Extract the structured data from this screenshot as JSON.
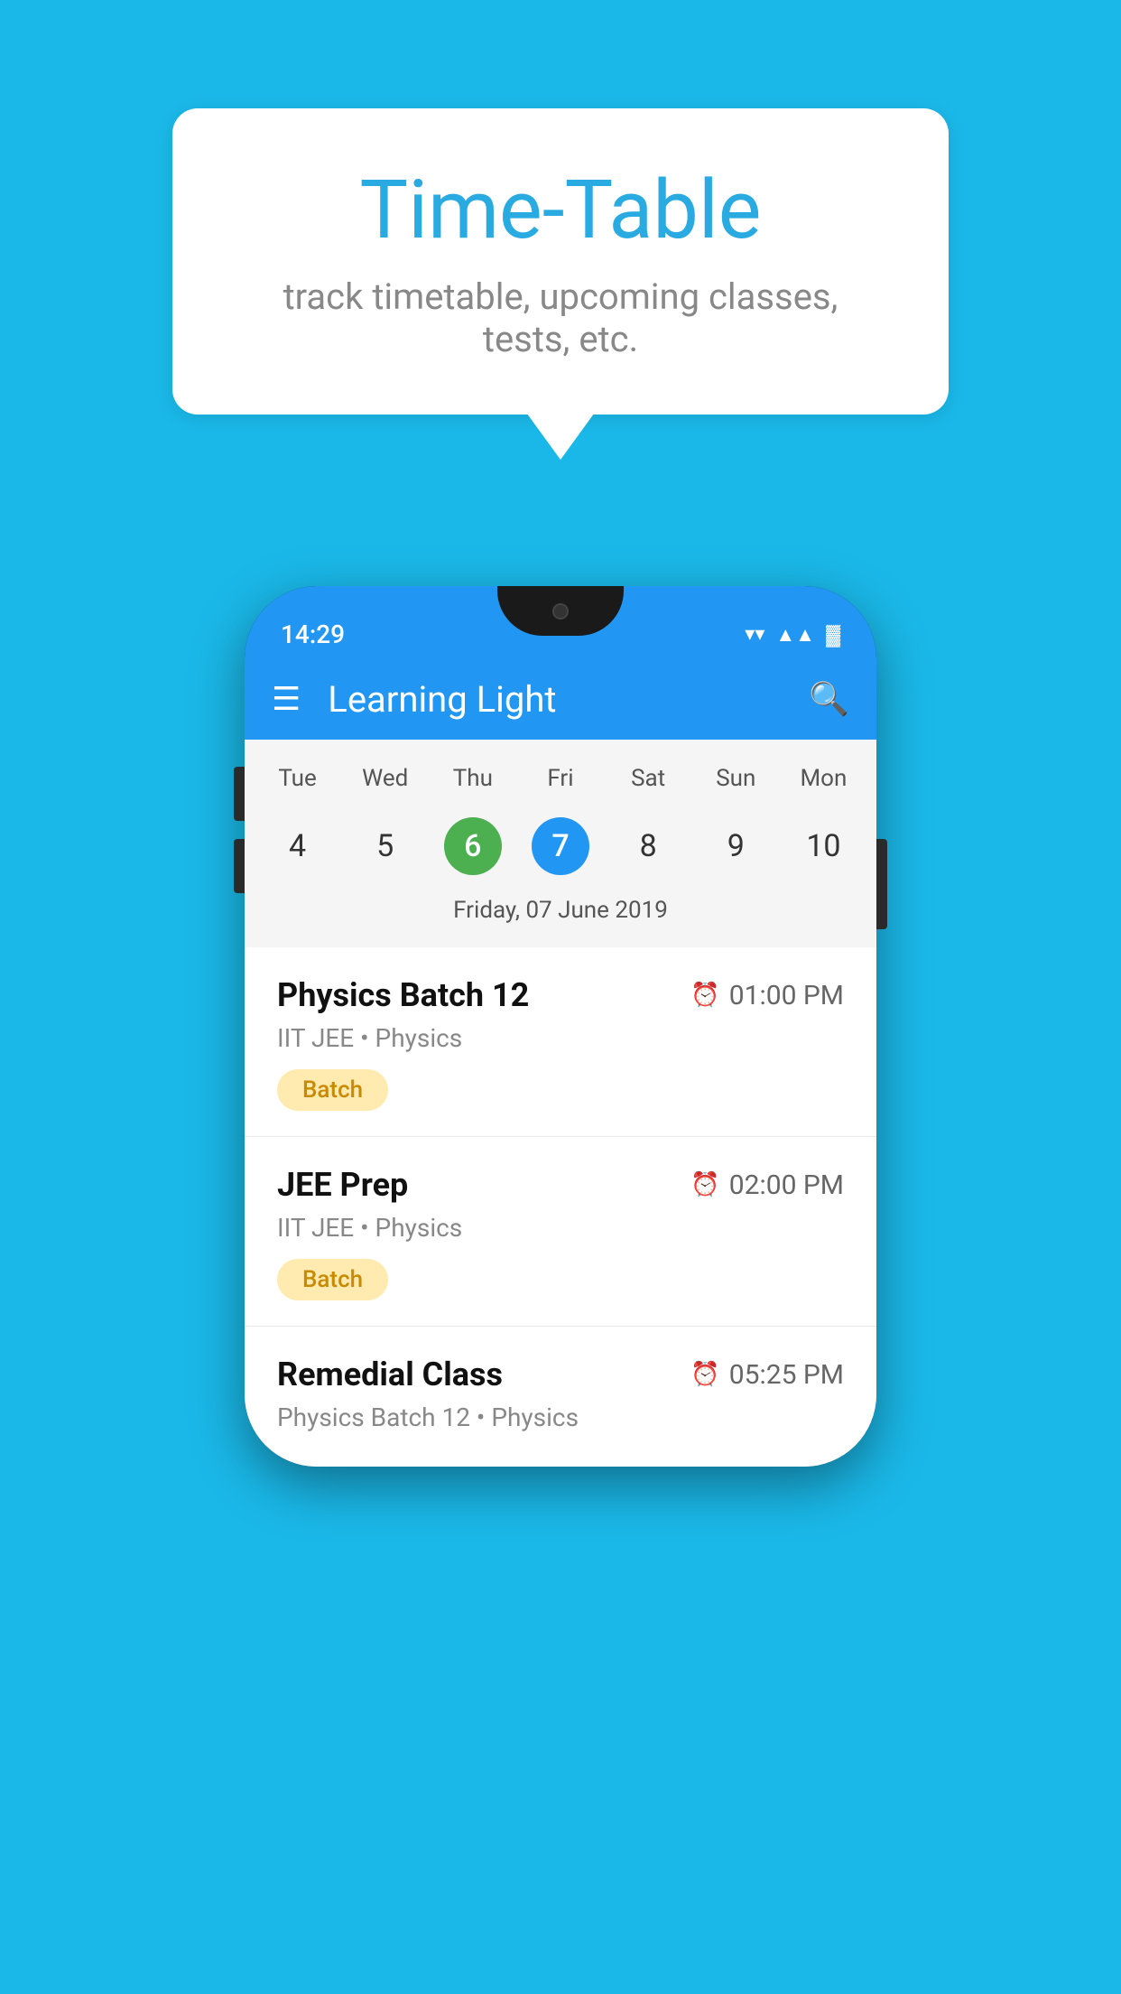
{
  "hero": {
    "title": "Time-Table",
    "subtitle": "track timetable, upcoming classes, tests, etc."
  },
  "statusBar": {
    "time": "14:29",
    "icons": [
      "wifi",
      "signal",
      "battery"
    ]
  },
  "appBar": {
    "title": "Learning Light"
  },
  "calendar": {
    "days": [
      "Tue",
      "Wed",
      "Thu",
      "Fri",
      "Sat",
      "Sun",
      "Mon"
    ],
    "dates": [
      "4",
      "5",
      "6",
      "7",
      "8",
      "9",
      "10"
    ],
    "todayIndex": 2,
    "selectedIndex": 3,
    "selectedLabel": "Friday, 07 June 2019"
  },
  "classes": [
    {
      "name": "Physics Batch 12",
      "time": "01:00 PM",
      "subject": "IIT JEE • Physics",
      "tag": "Batch"
    },
    {
      "name": "JEE Prep",
      "time": "02:00 PM",
      "subject": "IIT JEE • Physics",
      "tag": "Batch"
    },
    {
      "name": "Remedial Class",
      "time": "05:25 PM",
      "subject": "Physics Batch 12 • Physics",
      "tag": ""
    }
  ],
  "icons": {
    "menu": "≡",
    "search": "🔍",
    "clock": "🕐"
  },
  "colors": {
    "background": "#1ab8e8",
    "appBar": "#2196f3",
    "todayCircle": "#4caf50",
    "selectedCircle": "#2196f3",
    "batchTag": "#ffeab0",
    "batchTagText": "#c88a00"
  }
}
